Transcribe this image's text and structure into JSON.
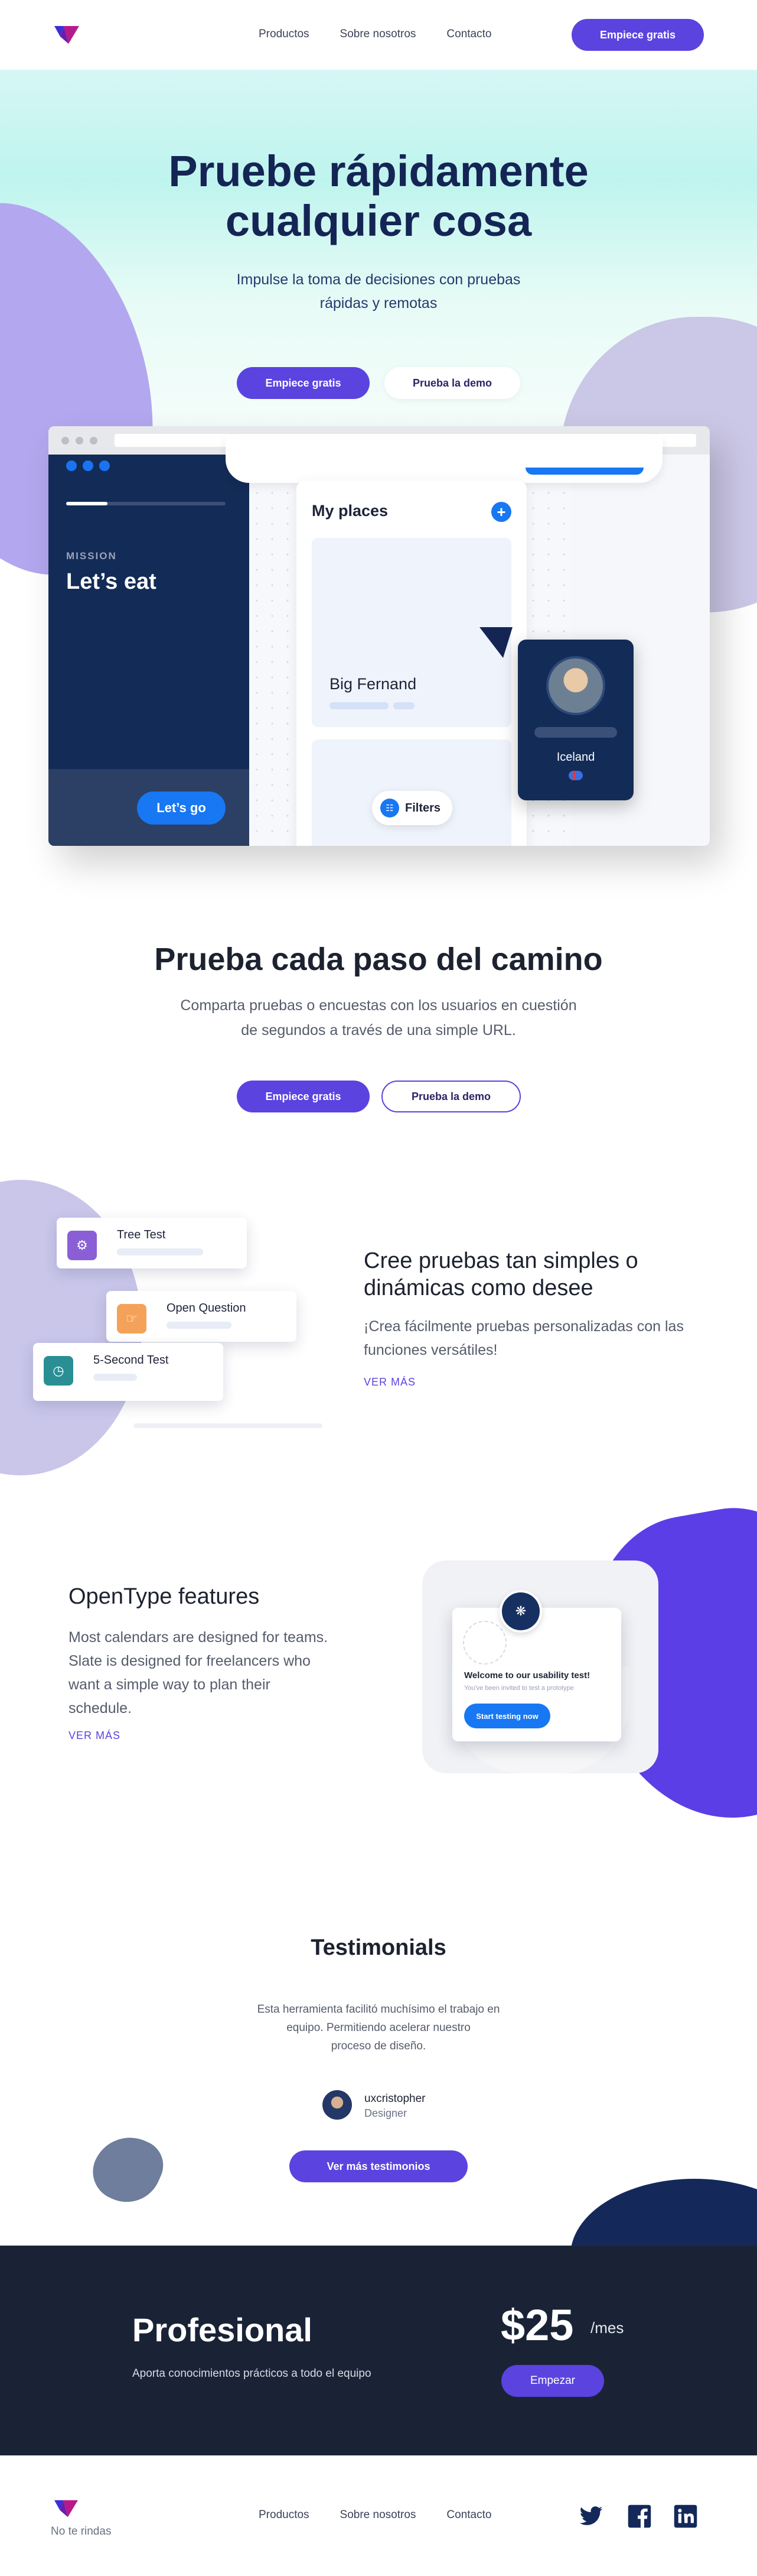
{
  "nav": {
    "links": [
      "Productos",
      "Sobre nosotros",
      "Contacto"
    ],
    "cta": "Empiece gratis"
  },
  "hero": {
    "title_line1": "Pruebe rápidamente",
    "title_line2": "cualquier cosa",
    "subtitle_line1": "Impulse la toma de decisiones con pruebas",
    "subtitle_line2": "rápidas y remotas",
    "primary_btn": "Empiece gratis",
    "secondary_btn": "Prueba la demo"
  },
  "mock": {
    "mission_label": "MISSION",
    "mission_title": "Let’s eat",
    "mission_progress": 0.26,
    "mission_btn": "Let’s go",
    "places_title": "My places",
    "places_add": "+",
    "place_name": "Big Fernand",
    "filters_label": "Filters",
    "profile_country": "Iceland"
  },
  "section2": {
    "title": "Prueba cada paso del camino",
    "subtitle_line1": "Comparta pruebas o encuestas con los usuarios en cuestión",
    "subtitle_line2": "de segundos a través de una simple URL.",
    "primary_btn": "Empiece gratis",
    "secondary_btn": "Prueba la demo"
  },
  "section3": {
    "cards": [
      {
        "name": "Tree Test",
        "icon": "tree-test-icon",
        "color": "#8a5fd6"
      },
      {
        "name": "Open Question",
        "icon": "open-question-icon",
        "color": "#f4a259"
      },
      {
        "name": "5-Second Test",
        "icon": "five-second-test-icon",
        "color": "#2a8f94"
      }
    ],
    "heading_line1": "Cree pruebas tan simples o",
    "heading_line2": "dinámicas como desee",
    "text_line1": "¡Crea fácilmente pruebas personalizadas con las",
    "text_line2": "funciones versátiles!",
    "link": "VER MÁS"
  },
  "section4": {
    "heading": "OpenType features",
    "text_lines": [
      "Most calendars are designed for teams.",
      "Slate is designed for freelancers who",
      "want a simple way to plan their",
      "schedule."
    ],
    "link": "VER MÁS",
    "card_welcome": "Welcome to our usability test!",
    "card_small": "You've been invited to test a prototype",
    "card_btn": "Start testing now"
  },
  "testimonials": {
    "heading": "Testimonials",
    "quote_lines": [
      "Esta herramienta facilitó muchísimo el trabajo en",
      "equipo. Permitiendo acelerar nuestro",
      "proceso de diseño."
    ],
    "author": "uxcristopher",
    "role": "Designer",
    "btn": "Ver más testimonios"
  },
  "pricing": {
    "plan": "Profesional",
    "description": "Aporta conocimientos prácticos a todo el equipo",
    "price": "$25",
    "period": "/mes",
    "btn": "Empezar"
  },
  "footer": {
    "tagline": "No te rindas",
    "links": [
      "Productos",
      "Sobre nosotros",
      "Contacto"
    ],
    "social": [
      "twitter-icon",
      "facebook-icon",
      "linkedin-icon"
    ]
  },
  "colors": {
    "accent": "#5b43e0",
    "navy": "#142555",
    "mock_blue": "#1877f2",
    "dark_band": "#1a2336"
  }
}
